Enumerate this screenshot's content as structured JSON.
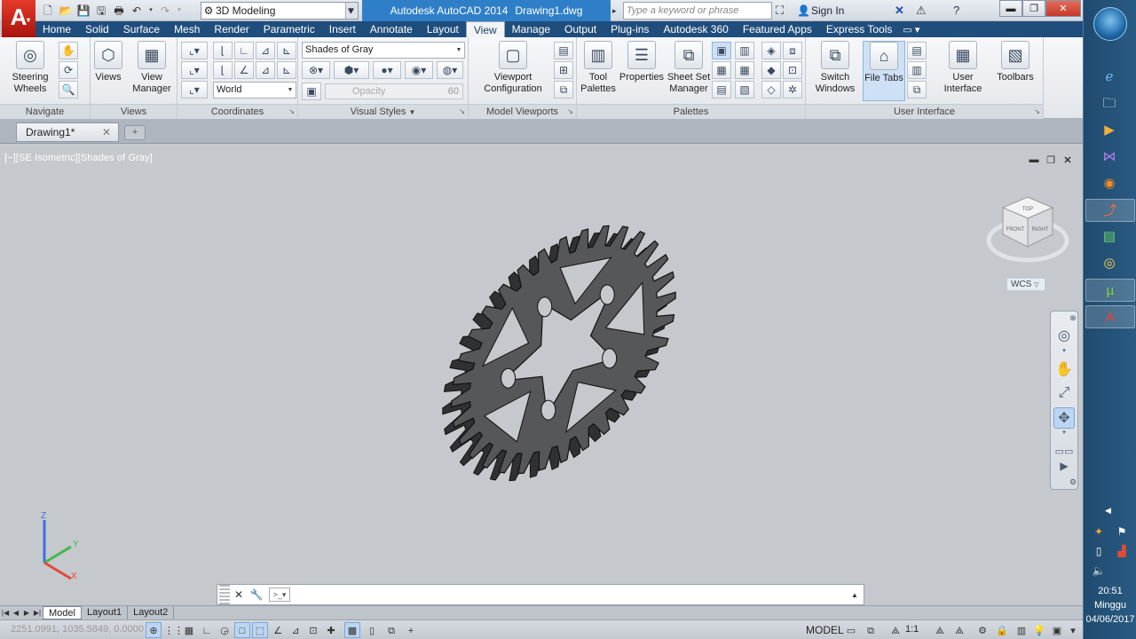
{
  "titlebar": {
    "logo": "A",
    "workspace": "3D Modeling",
    "app_title": "Autodesk AutoCAD 2014",
    "file_name": "Drawing1.dwg",
    "search_placeholder": "Type a keyword or phrase",
    "signin": "Sign In"
  },
  "ribbon_tabs": [
    "Home",
    "Solid",
    "Surface",
    "Mesh",
    "Render",
    "Parametric",
    "Insert",
    "Annotate",
    "Layout",
    "View",
    "Manage",
    "Output",
    "Plug-ins",
    "Autodesk 360",
    "Featured Apps",
    "Express Tools"
  ],
  "active_tab": "View",
  "panels": {
    "navigate": {
      "title": "Navigate",
      "steering": "Steering Wheels"
    },
    "views": {
      "title": "Views",
      "views": "Views",
      "view_manager": "View Manager"
    },
    "coordinates": {
      "title": "Coordinates",
      "ucs": "World"
    },
    "visual_styles": {
      "title": "Visual Styles",
      "style": "Shades of Gray",
      "opacity_label": "Opacity",
      "opacity_value": "60"
    },
    "model_viewports": {
      "title": "Model Viewports",
      "viewport_config": "Viewport Configuration"
    },
    "palettes": {
      "title": "Palettes",
      "tool_palettes": "Tool Palettes",
      "properties": "Properties",
      "sheet_set": "Sheet Set Manager"
    },
    "user_interface": {
      "title": "User Interface",
      "switch_windows": "Switch Windows",
      "file_tabs": "File Tabs",
      "user_interface": "User Interface",
      "toolbars": "Toolbars"
    }
  },
  "file_tab": {
    "name": "Drawing1*"
  },
  "viewport": {
    "label": "[−][SE Isometric][Shades of Gray]",
    "viewcube_faces": {
      "top": "TOP",
      "front": "FRONT",
      "right": "RIGHT"
    },
    "wcs": "WCS",
    "ucs_axes": {
      "x": "X",
      "y": "Y",
      "z": "Z"
    },
    "gear_teeth": 32,
    "gear_color": "#555759"
  },
  "command_line": {
    "value": ""
  },
  "layout_tabs": [
    "Model",
    "Layout1",
    "Layout2"
  ],
  "active_layout": "Model",
  "statusbar": {
    "coords": "2251.0991, 1035.5849, 0.0000",
    "model": "MODEL",
    "scale": "1:1"
  },
  "taskbar": {
    "time": "20:51",
    "day": "Minggu",
    "date": "04/06/2017"
  },
  "colors": {
    "accent": "#1f4e7d",
    "title_active": "#2f7fc8",
    "autocad_red": "#d8261a"
  }
}
